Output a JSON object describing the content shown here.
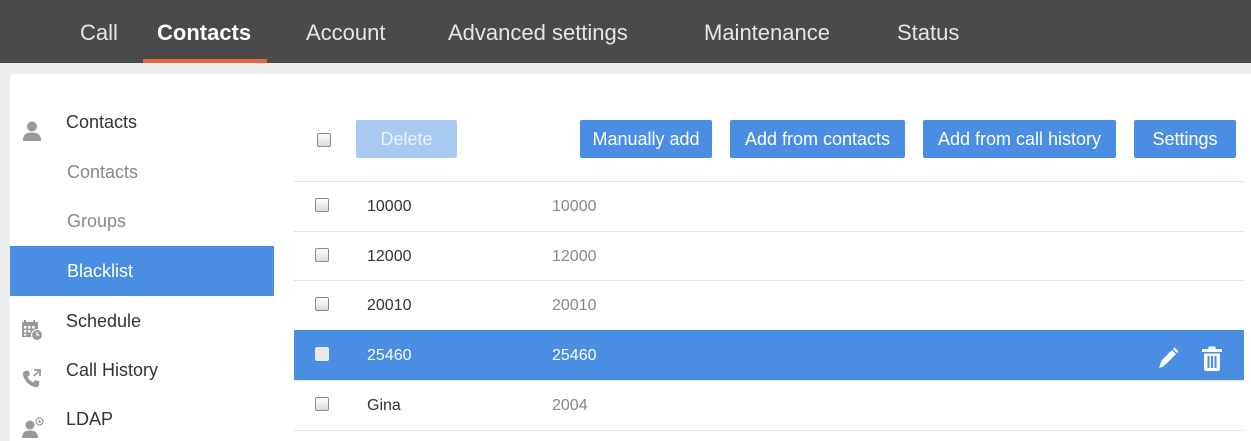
{
  "nav": {
    "tabs": [
      {
        "label": "Call"
      },
      {
        "label": "Contacts"
      },
      {
        "label": "Account"
      },
      {
        "label": "Advanced settings"
      },
      {
        "label": "Maintenance"
      },
      {
        "label": "Status"
      }
    ],
    "active_tab": "Contacts",
    "accent_color": "#e8643c"
  },
  "sidebar": {
    "items": [
      {
        "label": "Contacts",
        "icon": "person-icon"
      },
      {
        "label": "Contacts"
      },
      {
        "label": "Groups"
      },
      {
        "label": "Blacklist",
        "selected": true
      },
      {
        "label": "Schedule",
        "icon": "calendar-clock-icon"
      },
      {
        "label": "Call History",
        "icon": "phone-arrows-icon"
      },
      {
        "label": "LDAP",
        "icon": "person-at-icon"
      }
    ]
  },
  "toolbar": {
    "delete_label": "Delete",
    "manual_add_label": "Manually add",
    "add_from_contacts_label": "Add from contacts",
    "add_from_call_history_label": "Add from call history",
    "settings_label": "Settings"
  },
  "table": {
    "rows": [
      {
        "name": "10000",
        "number": "10000",
        "selected": false
      },
      {
        "name": "12000",
        "number": "12000",
        "selected": false
      },
      {
        "name": "20010",
        "number": "20010",
        "selected": false
      },
      {
        "name": "25460",
        "number": "25460",
        "selected": true
      },
      {
        "name": "Gina",
        "number": "2004",
        "selected": false
      }
    ],
    "row_actions": [
      "edit-icon",
      "trash-icon"
    ]
  },
  "colors": {
    "primary": "#4a8ee3",
    "nav_bg": "#4a4a4a"
  }
}
